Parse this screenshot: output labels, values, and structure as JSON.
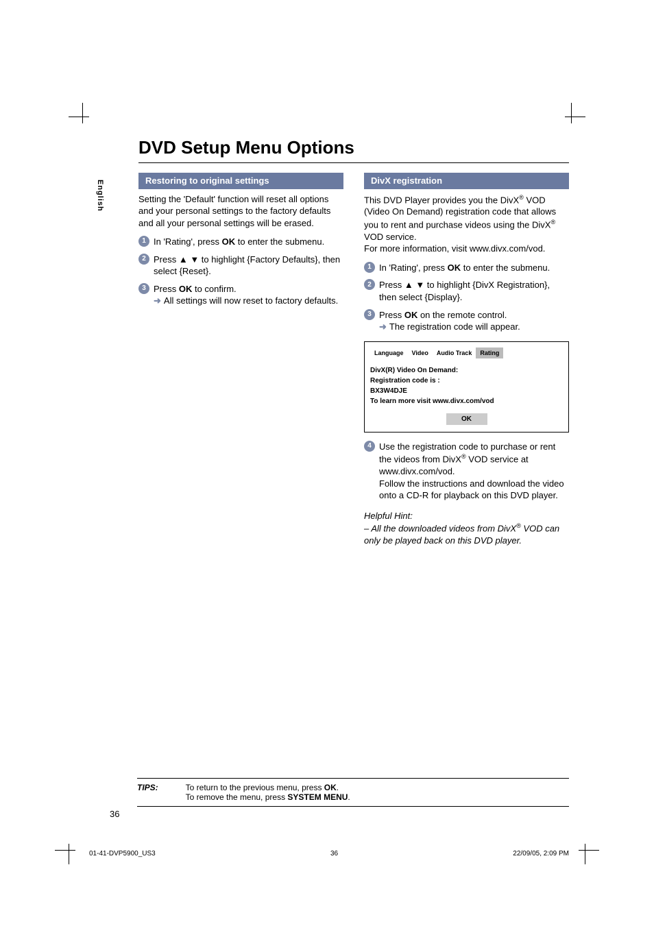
{
  "page_title": "DVD Setup Menu Options",
  "language_tab": "English",
  "left": {
    "header": "Restoring to original settings",
    "intro": "Setting the 'Default' function will reset all options and your personal settings to the factory defaults and all your personal settings will be erased.",
    "step1_a": "In 'Rating', press ",
    "step1_b": "OK",
    "step1_c": " to enter the submenu.",
    "step2": "Press ▲ ▼ to highlight {Factory Defaults}, then select {Reset}.",
    "step3_a": "Press ",
    "step3_b": "OK",
    "step3_c": " to confirm.",
    "step3_arrow": "All settings will now reset to factory defaults."
  },
  "right": {
    "header": "DivX registration",
    "intro1_a": "This DVD Player provides you the DivX",
    "intro1_b": " VOD (Video On Demand) registration code that allows you to rent and purchase videos using the DivX",
    "intro1_c": " VOD service.",
    "intro2": "For more information, visit www.divx.com/vod.",
    "step1_a": "In 'Rating', press ",
    "step1_b": "OK",
    "step1_c": " to enter the submenu.",
    "step2": "Press ▲ ▼ to highlight {DivX Registration}, then select {Display}.",
    "step3_a": "Press ",
    "step3_b": "OK",
    "step3_c": " on the remote control.",
    "step3_arrow": "The registration code will appear.",
    "menu": {
      "tab1": "Language",
      "tab2": "Video",
      "tab3": "Audio Track",
      "tab4": "Rating",
      "line1": "DivX(R) Video On Demand:",
      "line2": "Registration code is :",
      "line3": "BX3W4DJE",
      "line4": "To learn more visit www.divx.com/vod",
      "ok": "OK"
    },
    "step4_a": "Use the registration code to purchase or rent the videos from DivX",
    "step4_b": " VOD service at www.divx.com/vod.",
    "step4_c": "Follow the instructions and download the video onto a CD-R for playback on this DVD player.",
    "hint_label": "Helpful Hint:",
    "hint_a": "–  All the downloaded videos from DivX",
    "hint_b": " VOD can only be played back on this DVD player."
  },
  "tips": {
    "label": "TIPS:",
    "line1_a": "To return to the previous menu, press ",
    "line1_b": "OK",
    "line1_c": ".",
    "line2_a": "To remove the menu, press ",
    "line2_b": "SYSTEM MENU",
    "line2_c": "."
  },
  "page_number": "36",
  "footer": {
    "left": "01-41-DVP5900_US3",
    "center": "36",
    "right": "22/09/05, 2:09 PM"
  }
}
